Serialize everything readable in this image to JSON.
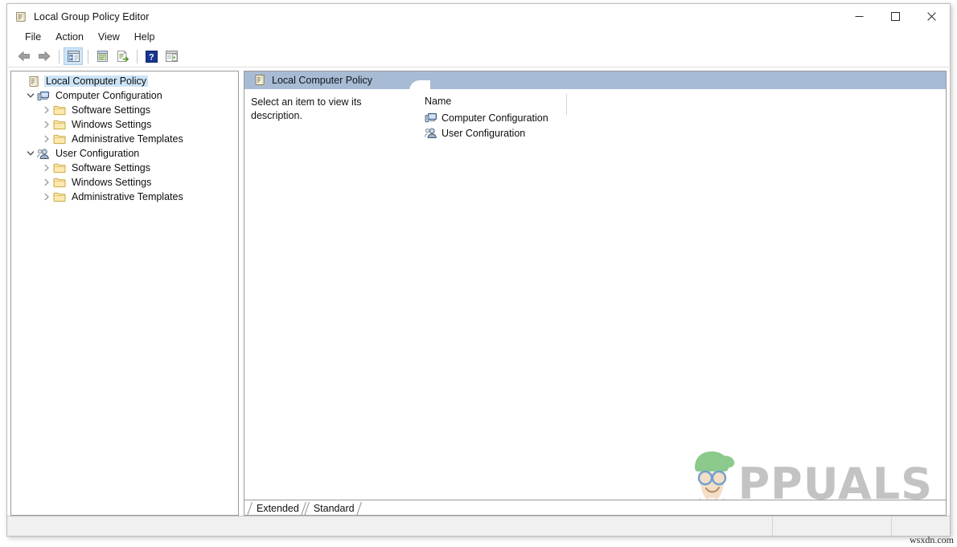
{
  "window": {
    "title": "Local Group Policy Editor",
    "title_icon": "policy-scroll-icon",
    "controls": {
      "minimize": "minimize-icon",
      "maximize": "maximize-icon",
      "close": "close-icon"
    }
  },
  "menubar": {
    "items": [
      {
        "label": "File"
      },
      {
        "label": "Action"
      },
      {
        "label": "View"
      },
      {
        "label": "Help"
      }
    ]
  },
  "toolbar": {
    "buttons": [
      {
        "name": "back-icon",
        "tooltip": "Back"
      },
      {
        "name": "forward-icon",
        "tooltip": "Forward"
      },
      {
        "name": "show-hide-console-tree-icon",
        "tooltip": "Show/Hide Console Tree",
        "active": true
      },
      {
        "name": "properties-icon",
        "tooltip": "Properties"
      },
      {
        "name": "export-list-icon",
        "tooltip": "Export List"
      },
      {
        "name": "help-icon",
        "tooltip": "Help"
      },
      {
        "name": "show-hide-action-pane-icon",
        "tooltip": "Show/Hide Action Pane"
      }
    ]
  },
  "tree": {
    "nodes": [
      {
        "label": "Local Computer Policy",
        "icon": "policy-scroll-icon",
        "level": 0,
        "expander": "none",
        "selected": true
      },
      {
        "label": "Computer Configuration",
        "icon": "computer-icon",
        "level": 1,
        "expander": "expanded",
        "selected": false
      },
      {
        "label": "Software Settings",
        "icon": "folder-icon",
        "level": 2,
        "expander": "collapsed",
        "selected": false
      },
      {
        "label": "Windows Settings",
        "icon": "folder-icon",
        "level": 2,
        "expander": "collapsed",
        "selected": false
      },
      {
        "label": "Administrative Templates",
        "icon": "folder-icon",
        "level": 2,
        "expander": "collapsed",
        "selected": false
      },
      {
        "label": "User Configuration",
        "icon": "user-icon",
        "level": 1,
        "expander": "expanded",
        "selected": false
      },
      {
        "label": "Software Settings",
        "icon": "folder-icon",
        "level": 2,
        "expander": "collapsed",
        "selected": false
      },
      {
        "label": "Windows Settings",
        "icon": "folder-icon",
        "level": 2,
        "expander": "collapsed",
        "selected": false
      },
      {
        "label": "Administrative Templates",
        "icon": "folder-icon",
        "level": 2,
        "expander": "collapsed",
        "selected": false
      }
    ]
  },
  "right_pane": {
    "header_title": "Local Computer Policy",
    "header_icon": "policy-scroll-icon",
    "description": "Select an item to view its description.",
    "columns": [
      {
        "label": "Name"
      }
    ],
    "rows": [
      {
        "name": "Computer Configuration",
        "icon": "computer-icon"
      },
      {
        "name": "User Configuration",
        "icon": "user-icon"
      }
    ]
  },
  "tabs": {
    "items": [
      {
        "label": "Extended",
        "active": true
      },
      {
        "label": "Standard",
        "active": false
      }
    ]
  },
  "statusbar": {
    "panes": [
      "",
      "",
      ""
    ]
  },
  "watermark": {
    "brand": "PPUALS",
    "credit": "wsxdn.com"
  },
  "colors": {
    "pane_header": "#a7bcd4",
    "selection": "#cce4f7",
    "toolbar_active": "#cfe4f7",
    "window_border": "#bdbdbd",
    "pane_border": "#9a9a9a",
    "statusbar_bg": "#f0f0f0"
  }
}
